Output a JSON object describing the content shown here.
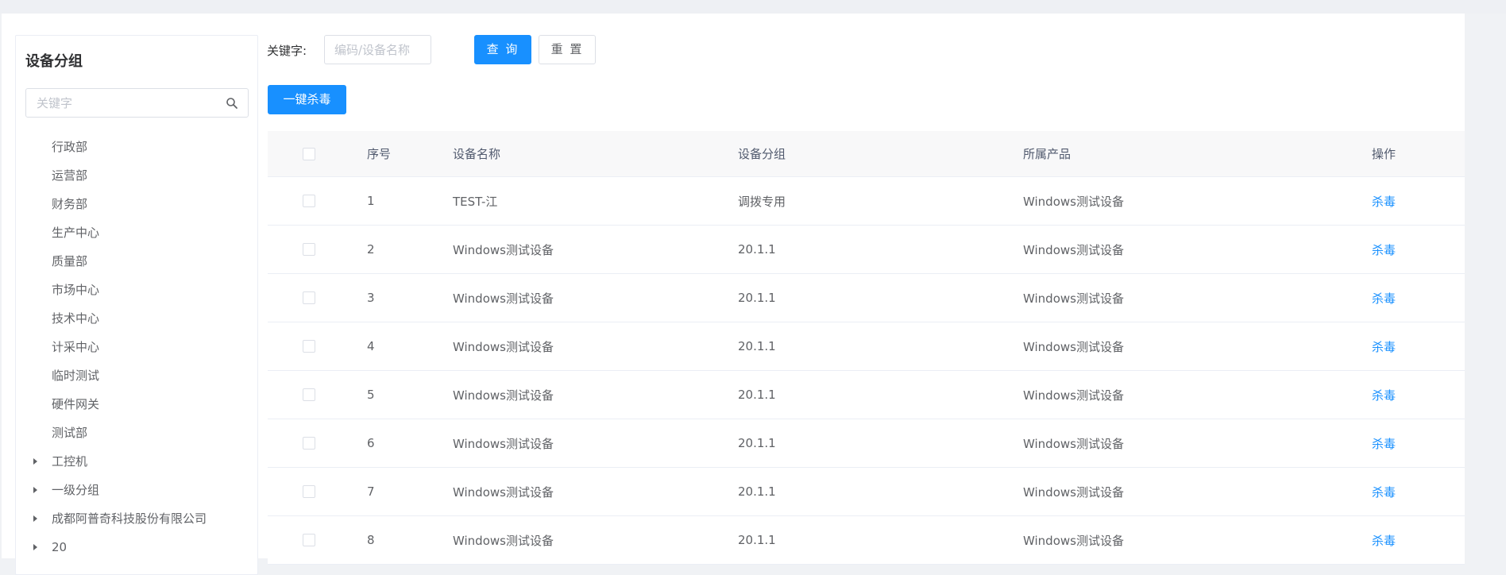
{
  "tree": {
    "title": "设备分组",
    "search_placeholder": "关键字",
    "nodes": [
      {
        "label": "行政部",
        "expandable": false
      },
      {
        "label": "运营部",
        "expandable": false
      },
      {
        "label": "财务部",
        "expandable": false
      },
      {
        "label": "生产中心",
        "expandable": false
      },
      {
        "label": "质量部",
        "expandable": false
      },
      {
        "label": "市场中心",
        "expandable": false
      },
      {
        "label": "技术中心",
        "expandable": false
      },
      {
        "label": "计采中心",
        "expandable": false
      },
      {
        "label": "临时测试",
        "expandable": false
      },
      {
        "label": "硬件网关",
        "expandable": false
      },
      {
        "label": "测试部",
        "expandable": false
      },
      {
        "label": "工控机",
        "expandable": true
      },
      {
        "label": "一级分组",
        "expandable": true
      },
      {
        "label": "成都阿普奇科技股份有限公司",
        "expandable": true
      },
      {
        "label": "20",
        "expandable": true
      }
    ]
  },
  "filter": {
    "keyword_label": "关键字:",
    "keyword_placeholder": "编码/设备名称",
    "query_label": "查 询",
    "reset_label": "重 置"
  },
  "toolbar": {
    "kill_all_label": "一键杀毒"
  },
  "table": {
    "columns": [
      "序号",
      "设备名称",
      "设备分组",
      "所属产品",
      "操作"
    ],
    "rows": [
      {
        "index": "1",
        "name": "TEST-江",
        "group": "调拨专用",
        "product": "Windows测试设备",
        "action": "杀毒"
      },
      {
        "index": "2",
        "name": "Windows测试设备",
        "group": "20.1.1",
        "product": "Windows测试设备",
        "action": "杀毒"
      },
      {
        "index": "3",
        "name": "Windows测试设备",
        "group": "20.1.1",
        "product": "Windows测试设备",
        "action": "杀毒"
      },
      {
        "index": "4",
        "name": "Windows测试设备",
        "group": "20.1.1",
        "product": "Windows测试设备",
        "action": "杀毒"
      },
      {
        "index": "5",
        "name": "Windows测试设备",
        "group": "20.1.1",
        "product": "Windows测试设备",
        "action": "杀毒"
      },
      {
        "index": "6",
        "name": "Windows测试设备",
        "group": "20.1.1",
        "product": "Windows测试设备",
        "action": "杀毒"
      },
      {
        "index": "7",
        "name": "Windows测试设备",
        "group": "20.1.1",
        "product": "Windows测试设备",
        "action": "杀毒"
      },
      {
        "index": "8",
        "name": "Windows测试设备",
        "group": "20.1.1",
        "product": "Windows测试设备",
        "action": "杀毒"
      }
    ]
  },
  "colors": {
    "primary": "#1890ff",
    "border": "#dcdfe6",
    "header_bg": "#f8f8f9"
  }
}
